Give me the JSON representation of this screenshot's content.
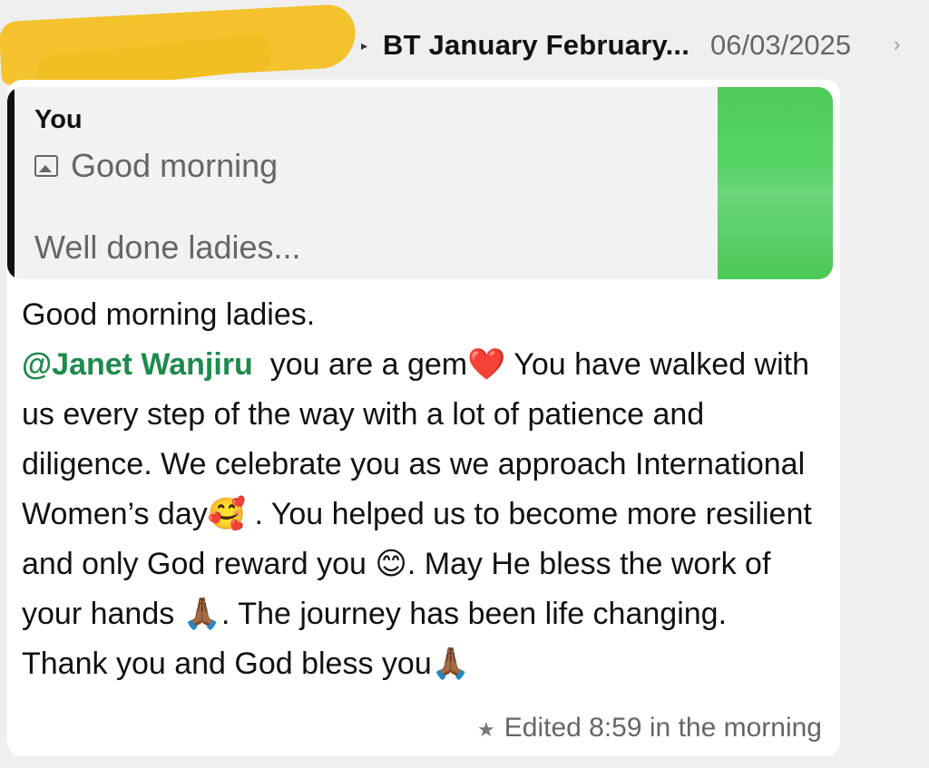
{
  "header": {
    "group_name": "BT January February...",
    "date": "06/03/2025"
  },
  "quoted": {
    "author": "You",
    "line1": "Good morning",
    "line2": "Well done ladies..."
  },
  "message": {
    "line1": "Good morning ladies.",
    "mention": "@Janet Wanjiru",
    "text_a": "you are a gem",
    "emoji_heart": "❤️",
    "text_b": "You have walked with us every step of the way with a lot of patience and diligence. We celebrate you as we approach International Women’s day",
    "emoji_love": "🥰",
    "text_c": ". You helped us to become more resilient and only God reward you",
    "emoji_smile": "😊",
    "text_d": ". May He bless the work of your hands",
    "emoji_pray": "🙏🏾",
    "text_e": ". The journey has been life changing. Thank you and God bless you",
    "emoji_pray2": "🙏🏾"
  },
  "meta": {
    "status": "Edited 8:59 in the morning",
    "icon": "star-icon"
  },
  "colors": {
    "mention": "#1e8a4c",
    "redaction": "#f2bf22"
  }
}
